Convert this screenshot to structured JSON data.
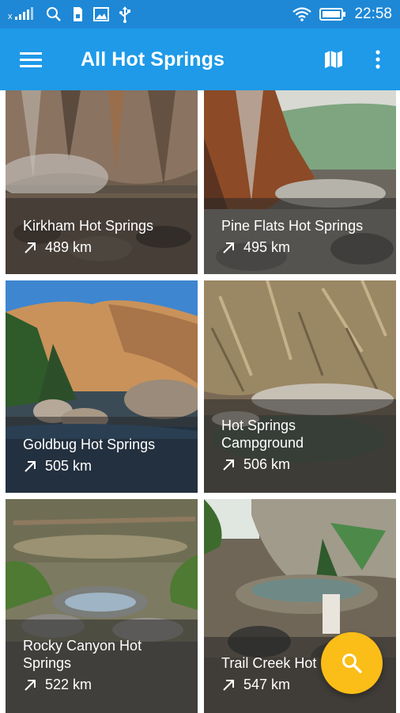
{
  "status_bar": {
    "time": "22:58",
    "icons": [
      "signal-icon",
      "search-icon",
      "sim-icon",
      "image-icon",
      "usb-icon",
      "wifi-icon",
      "battery-icon"
    ]
  },
  "app_bar": {
    "title": "All Hot Springs",
    "background": "#1e9ae8",
    "actions": [
      "map-icon",
      "more-vert-icon"
    ]
  },
  "springs": [
    {
      "name": "Kirkham Hot Springs",
      "distance": "489 km"
    },
    {
      "name": "Pine Flats Hot Springs",
      "distance": "495 km"
    },
    {
      "name": "Goldbug Hot Springs",
      "distance": "505 km"
    },
    {
      "name": "Hot Springs Campground",
      "distance": "506 km"
    },
    {
      "name": "Rocky Canyon Hot Springs",
      "distance": "522 km"
    },
    {
      "name": "Trail Creek Hot Springs",
      "distance": "547 km"
    }
  ],
  "fab": {
    "icon": "search-icon",
    "color": "#fbbd17"
  }
}
